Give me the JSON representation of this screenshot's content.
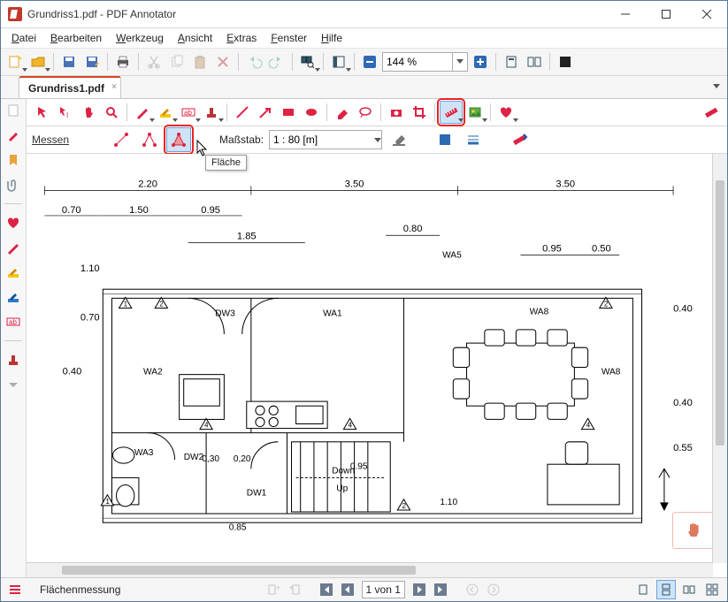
{
  "window": {
    "title": "Grundriss1.pdf - PDF Annotator"
  },
  "menu": {
    "items": [
      "Datei",
      "Bearbeiten",
      "Werkzeug",
      "Ansicht",
      "Extras",
      "Fenster",
      "Hilfe"
    ]
  },
  "zoom": {
    "value": "144 %"
  },
  "tab": {
    "label": "Grundriss1.pdf"
  },
  "measure": {
    "title": "Messen",
    "scale_label": "Maßstab:",
    "scale_value": "1 : 80 [m]",
    "tooltip": "Fläche"
  },
  "floorplan": {
    "top_dims": [
      "2.20",
      "3.50",
      "3.50"
    ],
    "sub_dims": [
      "0.70",
      "1.50",
      "0.95"
    ],
    "inner_dims": [
      "1.85",
      "0.80",
      "0.95",
      "0.50"
    ],
    "left_dims": [
      "1.10",
      "0.70",
      "0.40"
    ],
    "right_dims": [
      "0.40",
      "0.40",
      "0.55"
    ],
    "bottom_dims": [
      "0.85",
      "0,30",
      "0,20",
      "0.95",
      "1.10"
    ],
    "room_labels": [
      "DW3",
      "WA1",
      "WA5",
      "WA8",
      "WA8",
      "WA2",
      "WA3",
      "DW2",
      "DW1",
      "Down",
      "Up"
    ],
    "numbers": [
      "1",
      "2",
      "3",
      "4"
    ]
  },
  "status": {
    "mode": "Flächenmessung",
    "page": "1 von 1"
  }
}
